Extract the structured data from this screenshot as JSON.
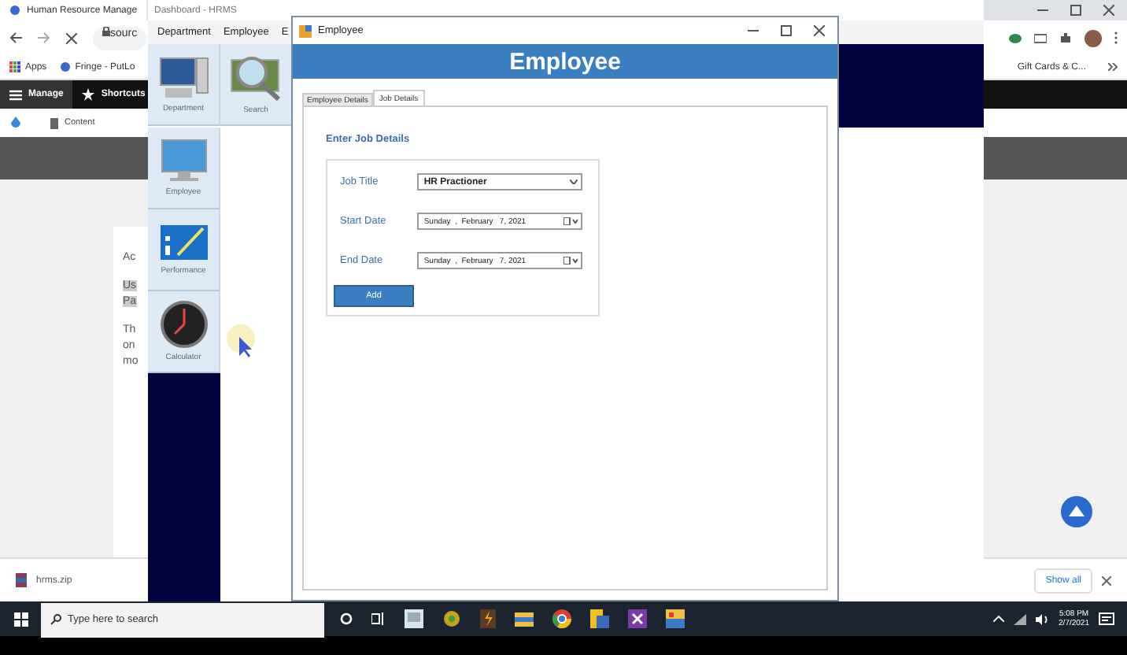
{
  "browser": {
    "tab_title": "Human Resource Manage",
    "address": "sourc",
    "bookmarks": [
      {
        "kind": "apps",
        "label": "Apps"
      },
      {
        "kind": "site",
        "label": "Fringe - PutLo"
      },
      {
        "kind": "site",
        "label": "Gift Cards & C..."
      }
    ],
    "admin_toolbar": [
      {
        "kind": "menu",
        "label": "Manage"
      },
      {
        "kind": "star",
        "label": "Shortcuts"
      }
    ],
    "subnav": [
      "Content"
    ],
    "content_lines": [
      {
        "text": "Ac",
        "highlighted": false
      },
      {
        "text": "Us",
        "highlighted": true
      },
      {
        "text": "Pa",
        "highlighted": true
      },
      {
        "text": "Th",
        "highlighted": false
      },
      {
        "text": "on",
        "highlighted": false
      },
      {
        "text": "mo",
        "highlighted": false
      }
    ],
    "download": {
      "file": "hrms.zip",
      "button": "Show all"
    }
  },
  "hrms": {
    "title": "Dashboard - HRMS",
    "menu": [
      "Department",
      "Employee",
      "E"
    ],
    "tiles": [
      {
        "kind": "department",
        "label": "Department"
      },
      {
        "kind": "search",
        "label": "Search"
      },
      {
        "kind": "employee",
        "label": "Employee"
      },
      {
        "kind": "performance",
        "label": "Performance"
      },
      {
        "kind": "calculator",
        "label": "Calculator"
      }
    ]
  },
  "dialog": {
    "title": "Employee",
    "header": "Employee",
    "tabs": [
      {
        "label": "Employee Details",
        "selected": false
      },
      {
        "label": "Job Details",
        "selected": true
      }
    ],
    "section_title": "Enter Job Details",
    "fields": [
      {
        "kind": "combo",
        "label": "Job Title",
        "value": "HR Practioner"
      },
      {
        "kind": "date",
        "label": "Start Date",
        "value": "Sunday  ,  February   7, 2021"
      },
      {
        "kind": "date",
        "label": "End Date",
        "value": "Sunday  ,  February   7, 2021"
      }
    ],
    "button": "Add"
  },
  "taskbar": {
    "search_placeholder": "Type here to search",
    "time": "5:08 PM",
    "date": "2/7/2021"
  }
}
